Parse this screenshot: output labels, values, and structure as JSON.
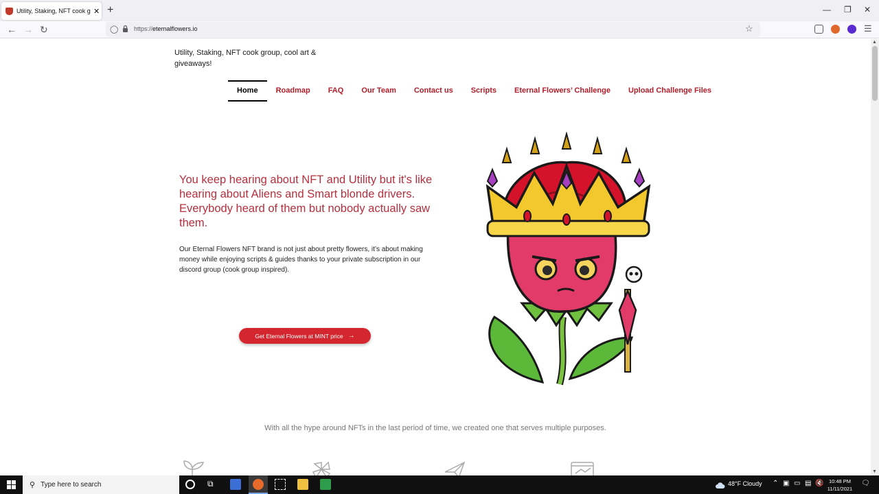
{
  "browser": {
    "tab_title": "Utility, Staking, NFT cook group",
    "tab_close": "✕",
    "new_tab": "+",
    "url_scheme": "https://",
    "url_host": "eternalflowers.io"
  },
  "page": {
    "tagline": "Utility, Staking, NFT cook group, cool art & giveaways!",
    "menu": [
      {
        "label": "Home",
        "active": true
      },
      {
        "label": "Roadmap"
      },
      {
        "label": "FAQ"
      },
      {
        "label": "Our Team"
      },
      {
        "label": "Contact us"
      },
      {
        "label": "Scripts"
      },
      {
        "label": "Eternal Flowers’ Challenge"
      },
      {
        "label": "Upload Challenge Files"
      }
    ],
    "headline": "You keep hearing about NFT and Utility but it's like hearing about Aliens and Smart blonde drivers. Everybody heard of them but nobody actually saw them.",
    "intro": "Our Eternal Flowers NFT brand is not just about pretty flowers, it’s about making money while enjoying scripts & guides thanks to your private subscription in our discord group (cook group inspired).",
    "cta_label": "Get Eternal Flowers at MINT price",
    "cta_arrow": "→",
    "purpose_text": "With all the hype around NFTs in the last period of time, we created one that serves multiple purposes."
  },
  "taskbar": {
    "search_placeholder": "Type here to search",
    "weather": "48°F  Cloudy",
    "time": "10:48 PM",
    "date": "11/11/2021"
  },
  "colors": {
    "accent": "#b01e28",
    "headline": "#b5303e",
    "cta": "#d3262e"
  }
}
